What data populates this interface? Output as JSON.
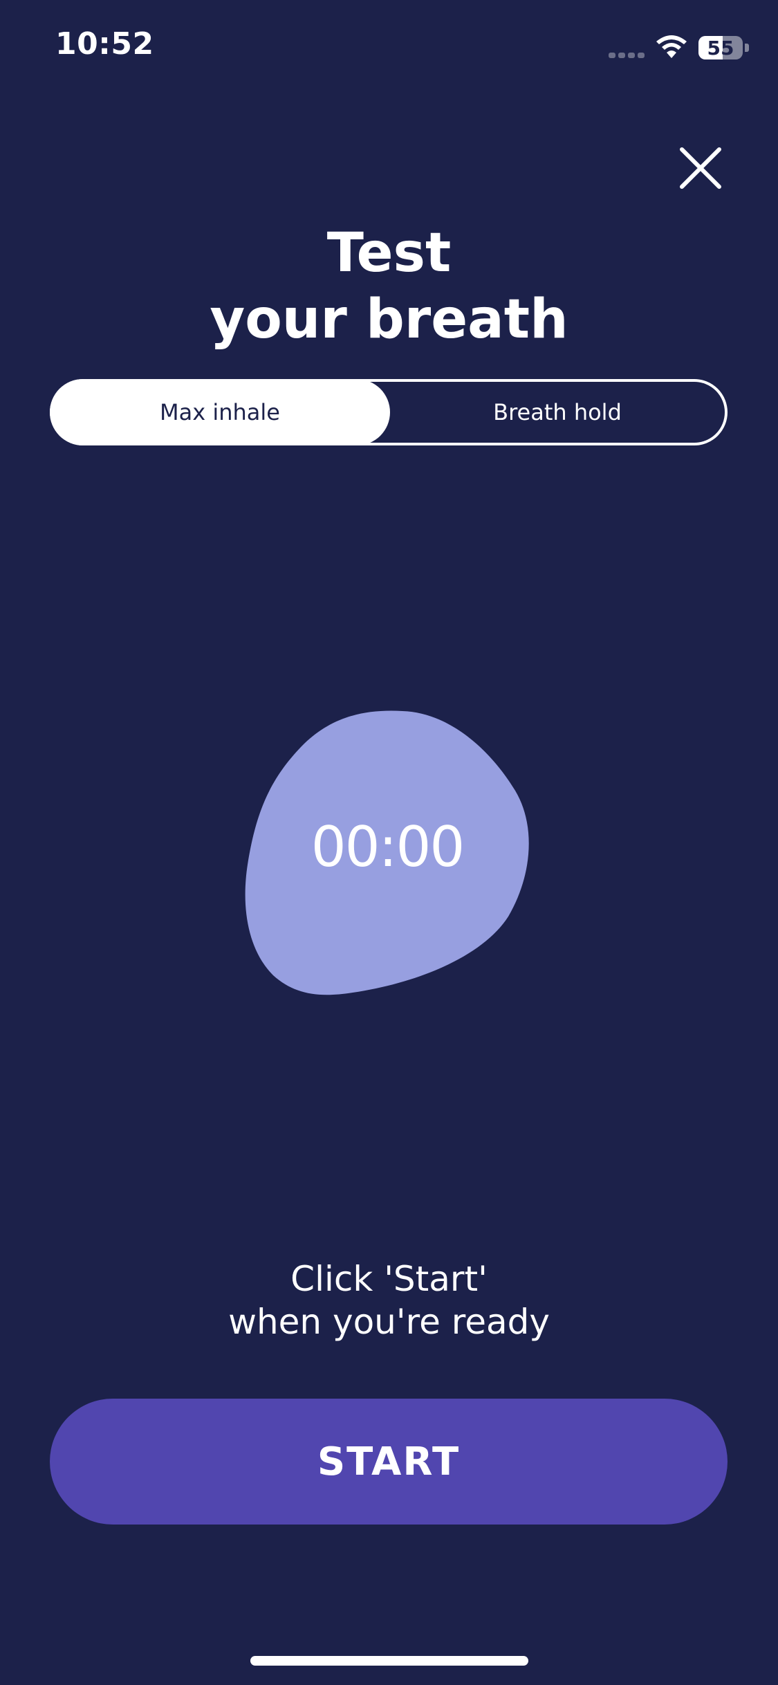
{
  "status_bar": {
    "time": "10:52",
    "battery_level": "55",
    "battery_fraction": 0.55
  },
  "header": {
    "title_line1": "Test",
    "title_line2": "your breath",
    "close_icon": "close-icon"
  },
  "tabs": [
    {
      "label": "Max inhale",
      "selected": true
    },
    {
      "label": "Breath hold",
      "selected": false
    }
  ],
  "timer": {
    "value": "00:00"
  },
  "instruction": {
    "line1": "Click 'Start'",
    "line2": "when you're ready"
  },
  "actions": {
    "start_label": "START"
  },
  "colors": {
    "background": "#1c214a",
    "blob": "#979fe0",
    "start_button": "#5146af",
    "text": "#ffffff"
  }
}
